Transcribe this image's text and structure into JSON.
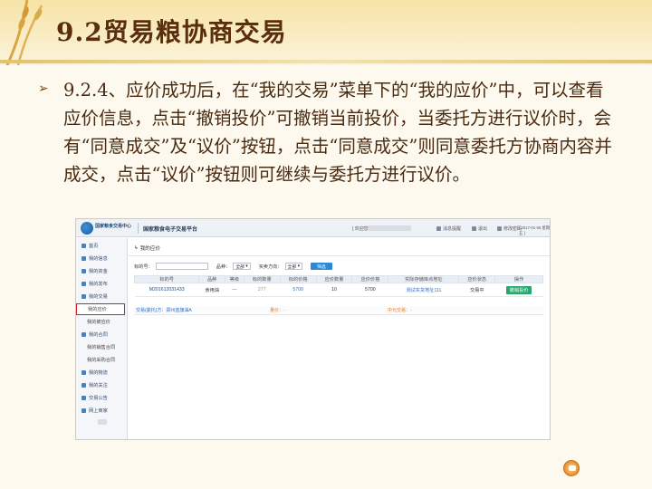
{
  "slide": {
    "title": "9.2贸易粮协商交易",
    "bullet": "9.2.4、应价成功后，在“我的交易”菜单下的“我的应价”中，可以查看应价信息，点击“撤销投价”可撤销当前投价，当委托方进行议价时，会有“同意成交”及“议价”按钮，点击“同意成交”则同意委托方协商内容并成交，点击“议价”按钮则可继续与委托方进行议价。"
  },
  "app": {
    "org_name": "国家粮食交易中心",
    "platform_name": "国家粮食电子交易平台",
    "welcome": "[ 欢迎您，",
    "top_links": [
      {
        "label": "消息提醒",
        "icon": "message-icon"
      },
      {
        "label": "退出",
        "icon": "power-icon"
      },
      {
        "label": "修改密码",
        "icon": "lock-icon"
      }
    ],
    "date": "[ 2017-01-06 星期五 ]",
    "sidebar": [
      {
        "label": "首页",
        "sub": false
      },
      {
        "label": "我的信息",
        "sub": false
      },
      {
        "label": "我的资金",
        "sub": false
      },
      {
        "label": "我的发布",
        "sub": false
      },
      {
        "label": "我的交易",
        "sub": false
      },
      {
        "label": "我的应价",
        "sub": true,
        "active": true
      },
      {
        "label": "我的被应价",
        "sub": true
      },
      {
        "label": "我的合同",
        "sub": false
      },
      {
        "label": "我的销售合同",
        "sub": true
      },
      {
        "label": "我的采购合同",
        "sub": true
      },
      {
        "label": "我的物流",
        "sub": false
      },
      {
        "label": "我的关注",
        "sub": false
      },
      {
        "label": "交易公告",
        "sub": false
      },
      {
        "label": "网上商家",
        "sub": false
      }
    ],
    "breadcrumb": "我的应价",
    "filters": {
      "code_label": "标的号：",
      "variety_label": "品种：",
      "variety_value": "全部",
      "direction_label": "买卖方向：",
      "direction_value": "全部",
      "button": "筛选"
    },
    "table": {
      "headers": [
        "标的号",
        "品种",
        "等级",
        "标的数量",
        "标的价格",
        "应价数量",
        "应价价格",
        "实际存储库点地址",
        "应价状态",
        "操作"
      ],
      "row": [
        "M201612031433",
        "食用油",
        "---",
        "277",
        "5700",
        "10",
        "5700",
        "测试实货地址111",
        "交易中",
        "撤销投价"
      ],
      "row2": {
        "seller": "交易(委托)方：郑州蓝旗油A",
        "delivery": "量价：-",
        "contact": "中元交易：-"
      }
    }
  }
}
